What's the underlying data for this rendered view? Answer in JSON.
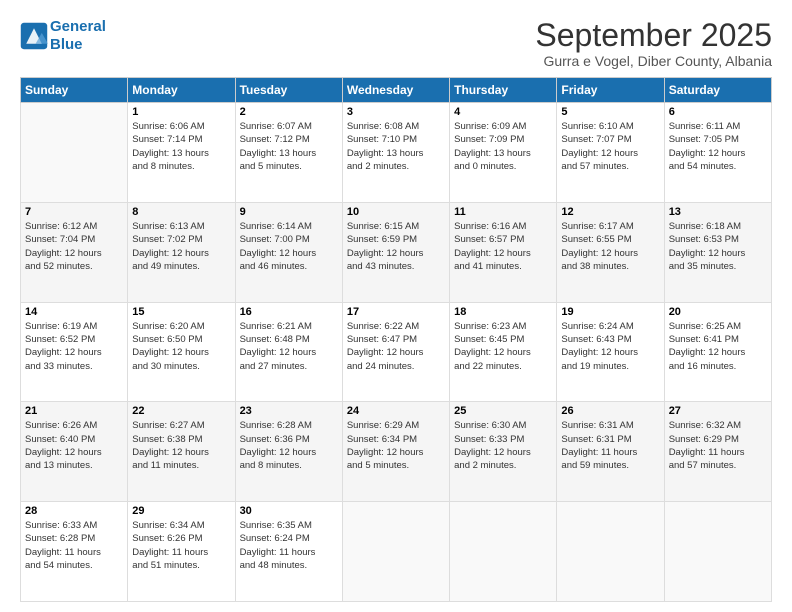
{
  "logo": {
    "line1": "General",
    "line2": "Blue"
  },
  "header": {
    "title": "September 2025",
    "location": "Gurra e Vogel, Diber County, Albania"
  },
  "weekdays": [
    "Sunday",
    "Monday",
    "Tuesday",
    "Wednesday",
    "Thursday",
    "Friday",
    "Saturday"
  ],
  "weeks": [
    [
      {
        "day": "",
        "info": ""
      },
      {
        "day": "1",
        "info": "Sunrise: 6:06 AM\nSunset: 7:14 PM\nDaylight: 13 hours\nand 8 minutes."
      },
      {
        "day": "2",
        "info": "Sunrise: 6:07 AM\nSunset: 7:12 PM\nDaylight: 13 hours\nand 5 minutes."
      },
      {
        "day": "3",
        "info": "Sunrise: 6:08 AM\nSunset: 7:10 PM\nDaylight: 13 hours\nand 2 minutes."
      },
      {
        "day": "4",
        "info": "Sunrise: 6:09 AM\nSunset: 7:09 PM\nDaylight: 13 hours\nand 0 minutes."
      },
      {
        "day": "5",
        "info": "Sunrise: 6:10 AM\nSunset: 7:07 PM\nDaylight: 12 hours\nand 57 minutes."
      },
      {
        "day": "6",
        "info": "Sunrise: 6:11 AM\nSunset: 7:05 PM\nDaylight: 12 hours\nand 54 minutes."
      }
    ],
    [
      {
        "day": "7",
        "info": "Sunrise: 6:12 AM\nSunset: 7:04 PM\nDaylight: 12 hours\nand 52 minutes."
      },
      {
        "day": "8",
        "info": "Sunrise: 6:13 AM\nSunset: 7:02 PM\nDaylight: 12 hours\nand 49 minutes."
      },
      {
        "day": "9",
        "info": "Sunrise: 6:14 AM\nSunset: 7:00 PM\nDaylight: 12 hours\nand 46 minutes."
      },
      {
        "day": "10",
        "info": "Sunrise: 6:15 AM\nSunset: 6:59 PM\nDaylight: 12 hours\nand 43 minutes."
      },
      {
        "day": "11",
        "info": "Sunrise: 6:16 AM\nSunset: 6:57 PM\nDaylight: 12 hours\nand 41 minutes."
      },
      {
        "day": "12",
        "info": "Sunrise: 6:17 AM\nSunset: 6:55 PM\nDaylight: 12 hours\nand 38 minutes."
      },
      {
        "day": "13",
        "info": "Sunrise: 6:18 AM\nSunset: 6:53 PM\nDaylight: 12 hours\nand 35 minutes."
      }
    ],
    [
      {
        "day": "14",
        "info": "Sunrise: 6:19 AM\nSunset: 6:52 PM\nDaylight: 12 hours\nand 33 minutes."
      },
      {
        "day": "15",
        "info": "Sunrise: 6:20 AM\nSunset: 6:50 PM\nDaylight: 12 hours\nand 30 minutes."
      },
      {
        "day": "16",
        "info": "Sunrise: 6:21 AM\nSunset: 6:48 PM\nDaylight: 12 hours\nand 27 minutes."
      },
      {
        "day": "17",
        "info": "Sunrise: 6:22 AM\nSunset: 6:47 PM\nDaylight: 12 hours\nand 24 minutes."
      },
      {
        "day": "18",
        "info": "Sunrise: 6:23 AM\nSunset: 6:45 PM\nDaylight: 12 hours\nand 22 minutes."
      },
      {
        "day": "19",
        "info": "Sunrise: 6:24 AM\nSunset: 6:43 PM\nDaylight: 12 hours\nand 19 minutes."
      },
      {
        "day": "20",
        "info": "Sunrise: 6:25 AM\nSunset: 6:41 PM\nDaylight: 12 hours\nand 16 minutes."
      }
    ],
    [
      {
        "day": "21",
        "info": "Sunrise: 6:26 AM\nSunset: 6:40 PM\nDaylight: 12 hours\nand 13 minutes."
      },
      {
        "day": "22",
        "info": "Sunrise: 6:27 AM\nSunset: 6:38 PM\nDaylight: 12 hours\nand 11 minutes."
      },
      {
        "day": "23",
        "info": "Sunrise: 6:28 AM\nSunset: 6:36 PM\nDaylight: 12 hours\nand 8 minutes."
      },
      {
        "day": "24",
        "info": "Sunrise: 6:29 AM\nSunset: 6:34 PM\nDaylight: 12 hours\nand 5 minutes."
      },
      {
        "day": "25",
        "info": "Sunrise: 6:30 AM\nSunset: 6:33 PM\nDaylight: 12 hours\nand 2 minutes."
      },
      {
        "day": "26",
        "info": "Sunrise: 6:31 AM\nSunset: 6:31 PM\nDaylight: 11 hours\nand 59 minutes."
      },
      {
        "day": "27",
        "info": "Sunrise: 6:32 AM\nSunset: 6:29 PM\nDaylight: 11 hours\nand 57 minutes."
      }
    ],
    [
      {
        "day": "28",
        "info": "Sunrise: 6:33 AM\nSunset: 6:28 PM\nDaylight: 11 hours\nand 54 minutes."
      },
      {
        "day": "29",
        "info": "Sunrise: 6:34 AM\nSunset: 6:26 PM\nDaylight: 11 hours\nand 51 minutes."
      },
      {
        "day": "30",
        "info": "Sunrise: 6:35 AM\nSunset: 6:24 PM\nDaylight: 11 hours\nand 48 minutes."
      },
      {
        "day": "",
        "info": ""
      },
      {
        "day": "",
        "info": ""
      },
      {
        "day": "",
        "info": ""
      },
      {
        "day": "",
        "info": ""
      }
    ]
  ]
}
